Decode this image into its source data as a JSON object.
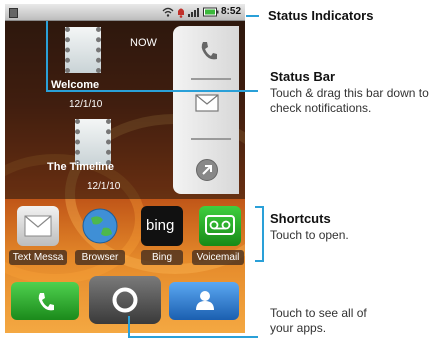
{
  "phone": {
    "status_time": "8:52",
    "widget": {
      "now_label": "NOW",
      "items": [
        {
          "title": "Welcome",
          "date": "12/1/10"
        },
        {
          "title": "The Timeline",
          "date": "12/1/10"
        }
      ]
    },
    "shortcuts": [
      {
        "label": "Text Messa",
        "icon": "message-icon"
      },
      {
        "label": "Browser",
        "icon": "globe-icon"
      },
      {
        "label": "Bing",
        "icon": "bing-icon",
        "logo_text": "bing"
      },
      {
        "label": "Voicemail",
        "icon": "voicemail-icon"
      }
    ],
    "dock": [
      {
        "icon": "phone-icon"
      },
      {
        "icon": "app-tray-icon"
      },
      {
        "icon": "contacts-icon"
      }
    ]
  },
  "annotations": {
    "status_indicators": {
      "title": "Status Indicators"
    },
    "status_bar": {
      "title": "Status Bar",
      "body": "Touch & drag this bar down to check notifications."
    },
    "shortcuts": {
      "title": "Shortcuts",
      "body": "Touch to open."
    },
    "apps": {
      "body": "Touch to see all of your apps."
    }
  },
  "colors": {
    "callout_line": "#2aa0d8"
  }
}
